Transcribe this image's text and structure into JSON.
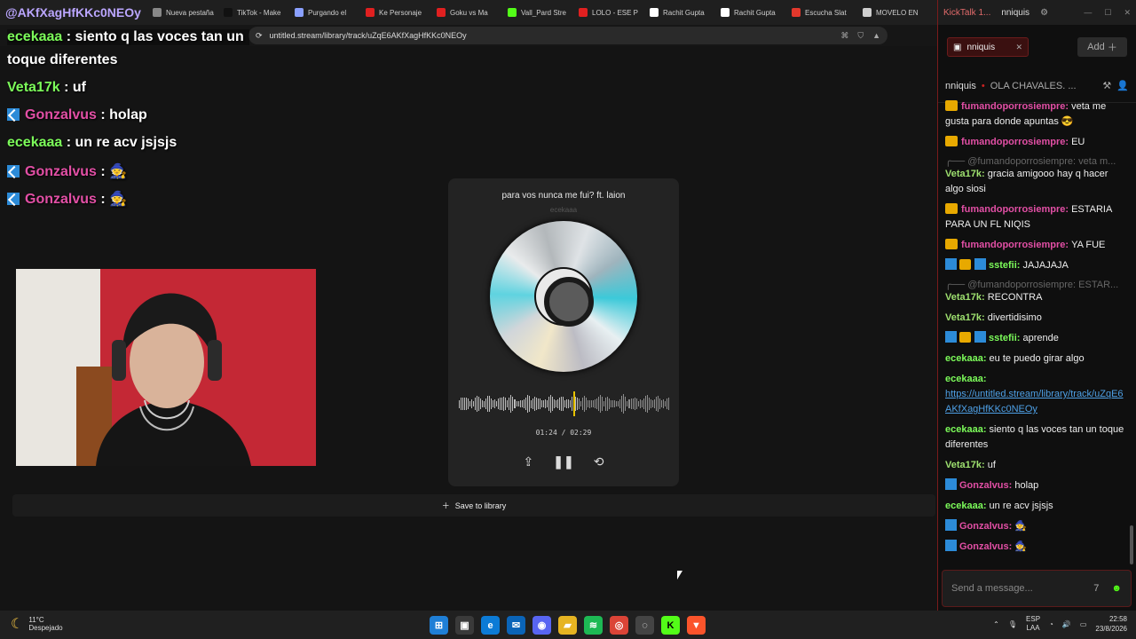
{
  "browser": {
    "tabs": [
      {
        "label": "@AKfXagHfKKc0NEOy",
        "color": "#c8c8c8"
      },
      {
        "label": "Nueva pestaña",
        "color": "#888888"
      },
      {
        "label": "TikTok - Make",
        "color": "#111111"
      },
      {
        "label": "Purgando el",
        "color": "#8aa0ff"
      },
      {
        "label": "Ke Personaje",
        "color": "#e02020"
      },
      {
        "label": "Goku vs Ma",
        "color": "#e02020"
      },
      {
        "label": "Vall_Pard Stre",
        "color": "#53fc18"
      },
      {
        "label": "LOLO - ESE P",
        "color": "#e02020"
      },
      {
        "label": "Rachit Gupta",
        "color": "#ffffff"
      },
      {
        "label": "Rachit Gupta",
        "color": "#ffffff"
      },
      {
        "label": "Escucha Slat",
        "color": "#e2382c"
      },
      {
        "label": "MOVELO EN",
        "color": "#cfcfcf"
      }
    ],
    "url": "untitled.stream/library/track/uZqE6AKfXagHfKKc0NEOy"
  },
  "overlay_chat": [
    {
      "user": "ecekaaa",
      "text": ": siento q las voces tan un",
      "color": "green",
      "badge": false
    },
    {
      "user": "",
      "text": "toque diferentes",
      "color": "green",
      "badge": false
    },
    {
      "user": "Veta17k",
      "text": ": uf",
      "color": "green",
      "badge": false
    },
    {
      "user": "Gonzalvus",
      "text": ": holap",
      "color": "pink",
      "badge": true
    },
    {
      "user": "ecekaaa",
      "text": ": un re acv jsjsjs",
      "color": "green",
      "badge": false
    },
    {
      "user": "Gonzalvus",
      "text": ": 🧙",
      "color": "pink",
      "badge": true
    },
    {
      "user": "Gonzalvus",
      "text": ": 🧙",
      "color": "pink",
      "badge": true
    }
  ],
  "player": {
    "title": "para vos nunca me fui? ft. laion",
    "artist": "ecekaaa",
    "time_current": "01:24",
    "time_total": "02:29",
    "progress": 0.56,
    "share_icon": "share-icon",
    "pause_icon": "pause-icon",
    "repeat_icon": "repeat-icon"
  },
  "save_label": "Save to library",
  "kick": {
    "app_title": "KickTalk 1...",
    "user": "nniquis",
    "tab_label": "nniquis",
    "add_label": "Add",
    "stream_user": "nniquis",
    "stream_title": "OLA CHAVALES. ...",
    "messages": [
      {
        "type": "msg",
        "badge": "crown",
        "user": "fumandoporrosiempre:",
        "ucolor": "u-p",
        "text": "veta me gusta para donde apuntas 😎"
      },
      {
        "type": "msg",
        "badge": "crown",
        "user": "fumandoporrosiempre:",
        "ucolor": "u-p",
        "text": "EU"
      },
      {
        "type": "reply",
        "text": "@fumandoporrosiempre: veta m..."
      },
      {
        "type": "msg",
        "badge": "",
        "user": "Veta17k:",
        "ucolor": "u-l",
        "text": "gracia amigooo hay q hacer algo siosi"
      },
      {
        "type": "msg",
        "badge": "crown",
        "user": "fumandoporrosiempre:",
        "ucolor": "u-p",
        "text": "ESTARIA PARA UN FL NIQIS"
      },
      {
        "type": "msg",
        "badge": "crown",
        "user": "fumandoporrosiempre:",
        "ucolor": "u-p",
        "text": "YA FUE"
      },
      {
        "type": "msg",
        "badge": "vip",
        "user": "sstefii:",
        "ucolor": "u-g",
        "text": "JAJAJAJA"
      },
      {
        "type": "reply",
        "text": "@fumandoporrosiempre: ESTAR..."
      },
      {
        "type": "msg",
        "badge": "",
        "user": "Veta17k:",
        "ucolor": "u-l",
        "text": "RECONTRA"
      },
      {
        "type": "msg",
        "badge": "",
        "user": "Veta17k:",
        "ucolor": "u-l",
        "text": "divertidisimo"
      },
      {
        "type": "msg",
        "badge": "vip",
        "user": "sstefii:",
        "ucolor": "u-g",
        "text": "aprende"
      },
      {
        "type": "msg",
        "badge": "",
        "user": "ecekaaa:",
        "ucolor": "u-g",
        "text": "eu te puedo girar algo"
      },
      {
        "type": "link",
        "badge": "",
        "user": "ecekaaa:",
        "ucolor": "u-g",
        "text": "https://untitled.stream/library/track/uZqE6AKfXagHfKKc0NEOy"
      },
      {
        "type": "msg",
        "badge": "",
        "user": "ecekaaa:",
        "ucolor": "u-g",
        "text": "siento q las voces tan un toque diferentes"
      },
      {
        "type": "msg",
        "badge": "",
        "user": "Veta17k:",
        "ucolor": "u-l",
        "text": "uf"
      },
      {
        "type": "msg",
        "badge": "vip1",
        "user": "Gonzalvus:",
        "ucolor": "u-p",
        "text": "holap"
      },
      {
        "type": "msg",
        "badge": "",
        "user": "ecekaaa:",
        "ucolor": "u-g",
        "text": "un re acv jsjsjs"
      },
      {
        "type": "msg",
        "badge": "vip1",
        "user": "Gonzalvus:",
        "ucolor": "u-p",
        "text": "🧙"
      },
      {
        "type": "msg",
        "badge": "vip1",
        "user": "Gonzalvus:",
        "ucolor": "u-p",
        "text": "🧙"
      }
    ],
    "input_placeholder": "Send a message..."
  },
  "taskbar": {
    "temp": "11°C",
    "weather": "Despejado",
    "lang_top": "ESP",
    "lang_bottom": "LAA",
    "time": "22:58",
    "date": "23/8/2026",
    "apps": [
      {
        "name": "start-icon",
        "glyph": "⊞",
        "bg": "#1f7fd6"
      },
      {
        "name": "task-view-icon",
        "glyph": "▣",
        "bg": "#3a3a3a"
      },
      {
        "name": "edge-icon",
        "glyph": "e",
        "bg": "#0c7bd6"
      },
      {
        "name": "outlook-icon",
        "glyph": "✉",
        "bg": "#0a64b8"
      },
      {
        "name": "discord-icon",
        "glyph": "◉",
        "bg": "#5865f2"
      },
      {
        "name": "folder-icon",
        "glyph": "▰",
        "bg": "#e6b422"
      },
      {
        "name": "spotify-icon",
        "glyph": "≋",
        "bg": "#1db954"
      },
      {
        "name": "chrome-icon",
        "glyph": "◎",
        "bg": "#db4437"
      },
      {
        "name": "obs-icon",
        "glyph": "◌",
        "bg": "#444444"
      },
      {
        "name": "kick-icon",
        "glyph": "K",
        "bg": "#53fc18"
      },
      {
        "name": "brave-icon",
        "glyph": "▼",
        "bg": "#fb542b"
      }
    ]
  }
}
